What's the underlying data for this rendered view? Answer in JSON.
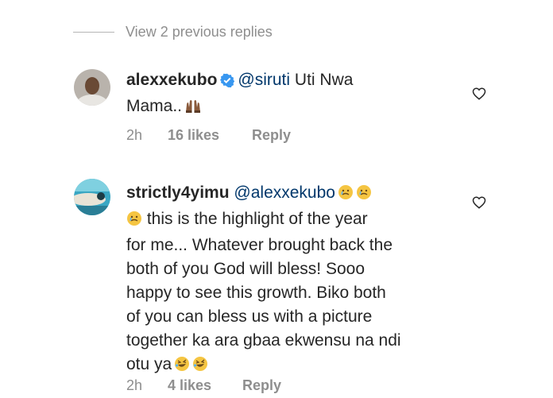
{
  "view_replies": {
    "label": "View 2 previous replies"
  },
  "comments": [
    {
      "username": "alexxekubo",
      "verified": true,
      "mention": "@siruti",
      "text_part1": " Uti Nwa",
      "text_part2": "Mama..",
      "emoji_after_text": "raised-hands",
      "time": "2h",
      "likes": "16 likes",
      "reply": "Reply"
    },
    {
      "username": "strictly4yimu",
      "verified": false,
      "mention": "@alexxekubo",
      "line2_text": " this is the highlight of the year",
      "line3": "for me... Whatever brought back the",
      "line4": "both of you God will bless! Sooo",
      "line5": "happy to see this growth. Biko both",
      "line6": "of you can bless us with a picture",
      "line7": "together ka ara gbaa ekwensu na ndi",
      "line8": "otu ya",
      "emoji_mention": "crying-face",
      "emoji_end": "rolling-laughing-face",
      "time": "2h",
      "likes": "4 likes",
      "reply": "Reply"
    }
  ],
  "colors": {
    "text": "#262626",
    "secondary": "#8e8e8e",
    "mention": "#00376b",
    "verified": "#3897f0"
  }
}
